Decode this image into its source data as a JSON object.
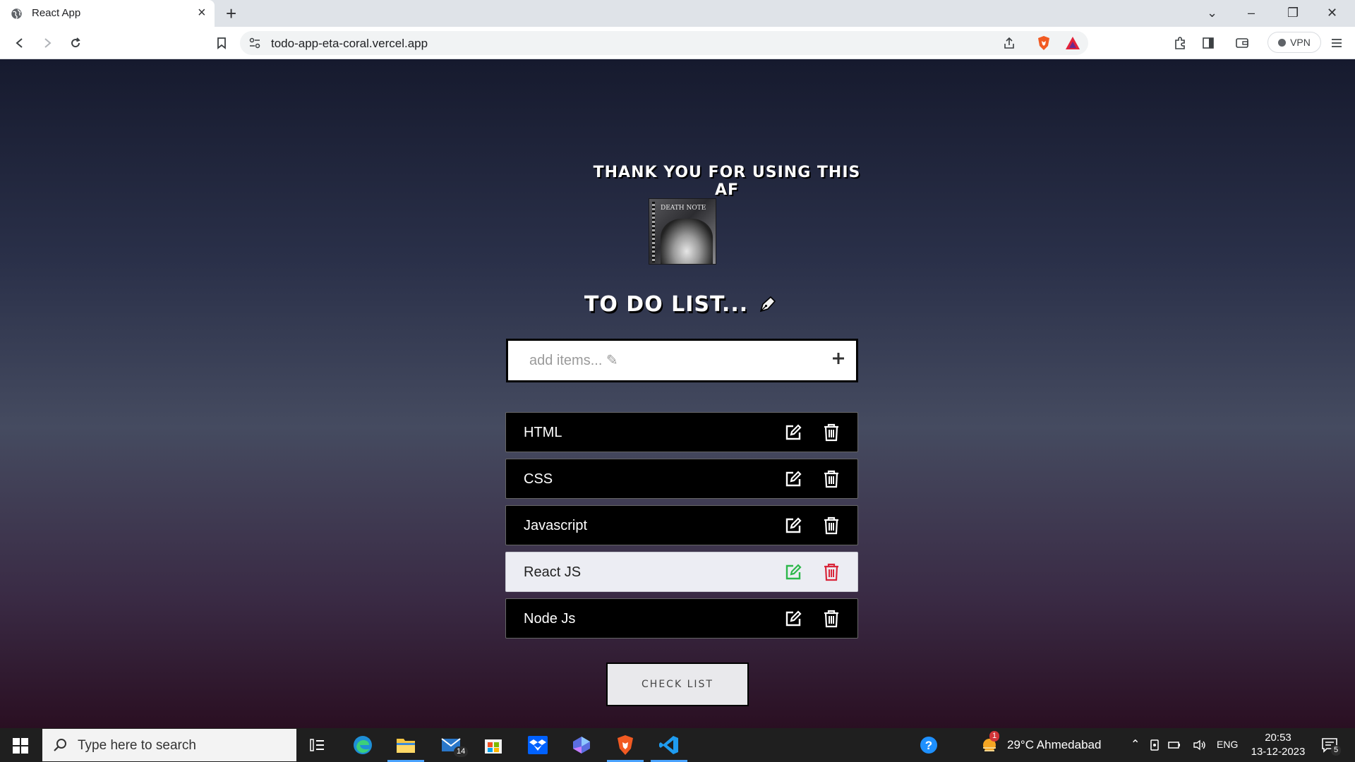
{
  "browser": {
    "tab_title": "React App",
    "url": "todo-app-eta-coral.vercel.app",
    "vpn_label": "VPN"
  },
  "page": {
    "thanks_text": "THANK YOU FOR USING THIS AF",
    "logo_text": "DEATH NOTE",
    "heading": "TO DO LIST...",
    "input_placeholder": "add items... ✎",
    "add_icon": "plus-icon",
    "items": [
      {
        "text": "HTML",
        "highlighted": false
      },
      {
        "text": "CSS",
        "highlighted": false
      },
      {
        "text": "Javascript",
        "highlighted": false
      },
      {
        "text": "React JS",
        "highlighted": true
      },
      {
        "text": "Node Js",
        "highlighted": false
      }
    ],
    "check_button": "CHECK LIST",
    "colors": {
      "edit_highlight": "#2db84b",
      "delete_highlight": "#d9263a",
      "item_bg": "#000000",
      "item_highlight_bg": "#ecedf3"
    }
  },
  "taskbar": {
    "search_placeholder": "Type here to search",
    "mail_badge": "14",
    "weather": "29°C  Ahmedabad",
    "weather_badge": "1",
    "language": "ENG",
    "time": "20:53",
    "date": "13-12-2023",
    "notifications": "5"
  }
}
